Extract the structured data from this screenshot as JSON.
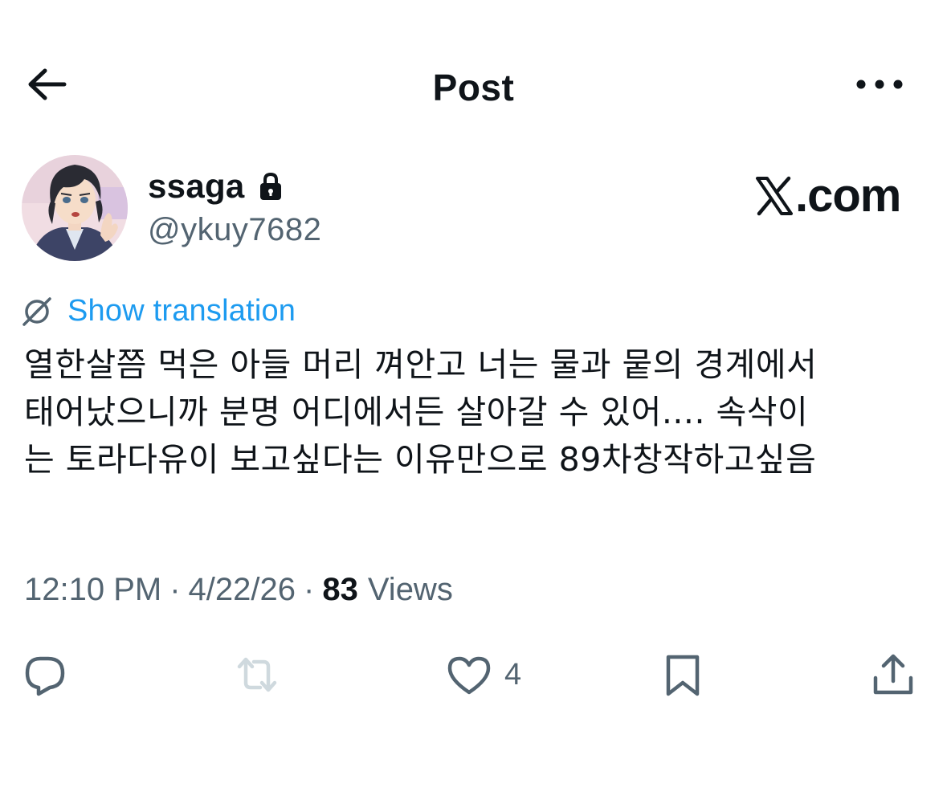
{
  "header": {
    "title": "Post",
    "back_icon": "arrow-left-icon",
    "more_icon": "more-horizontal-icon"
  },
  "author": {
    "display_name": "ssaga",
    "handle": "@ykuy7682",
    "protected_icon": "lock-icon"
  },
  "watermark": {
    "text": ".com",
    "logo_icon": "x-logo-icon"
  },
  "translation": {
    "label": "Show translation",
    "icon": "translate-icon"
  },
  "post": {
    "text": "열한살쯤 먹은 아들 머리 껴안고 너는 물과 뭍의 경계에서\n태어났으니까 분명 어디에서든 살아갈 수 있어.... 속삭이\n는 토라다유이 보고싶다는 이유만으로 89차창작하고싶음"
  },
  "meta": {
    "time": "12:10 PM",
    "separator": "·",
    "date": "4/22/26",
    "views_count": "83",
    "views_label": "Views"
  },
  "actions": {
    "reply_icon": "reply-icon",
    "repost_icon": "repost-icon",
    "like_icon": "heart-icon",
    "like_count": "4",
    "bookmark_icon": "bookmark-icon",
    "share_icon": "share-icon"
  },
  "colors": {
    "text": "#0f1419",
    "secondary": "#536471",
    "link": "#1d9bf0",
    "disabled": "#cfd9de"
  }
}
